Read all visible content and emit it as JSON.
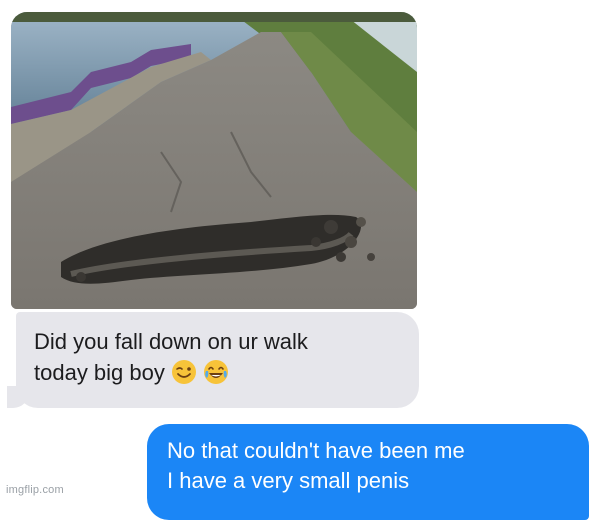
{
  "conversation": {
    "received": {
      "photo": {
        "alt_icon": "photo-attachment-icon"
      },
      "text_line1": "Did you fall down on ur walk",
      "text_line2": "today big boy",
      "emojis": [
        "winking-face-icon",
        "tears-of-joy-icon"
      ]
    },
    "sent": {
      "text_line1": "No that couldn't have been me",
      "text_line2": "I have a very small penis"
    }
  },
  "watermark": "imgflip.com",
  "colors": {
    "received_bubble": "#e6e6eb",
    "sent_bubble": "#1b86f6",
    "received_text": "#1c1c1e",
    "sent_text": "#ffffff"
  }
}
